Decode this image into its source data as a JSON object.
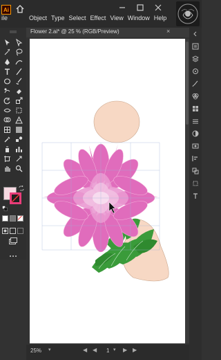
{
  "app": {
    "logo_text": "Ai",
    "left_menu_fragment": "ile"
  },
  "menu": {
    "items": [
      "Object",
      "Type",
      "Select",
      "Effect",
      "View",
      "Window",
      "Help"
    ]
  },
  "document": {
    "tab_title": "Flower 2.ai* @ 25 % (RGB/Preview)",
    "close_glyph": "×"
  },
  "status": {
    "zoom": "25%",
    "zoom_caret": "▾",
    "page": "1",
    "prev_glyph": "◀",
    "next_glyph": "▶"
  },
  "colors": {
    "fill": "#f7d9e2",
    "stroke": "#e83d7a",
    "accent": "#ff9a00",
    "petal": "#e06cbc",
    "leaf": "#3a9b3a",
    "skin": "#f7d8c4"
  }
}
